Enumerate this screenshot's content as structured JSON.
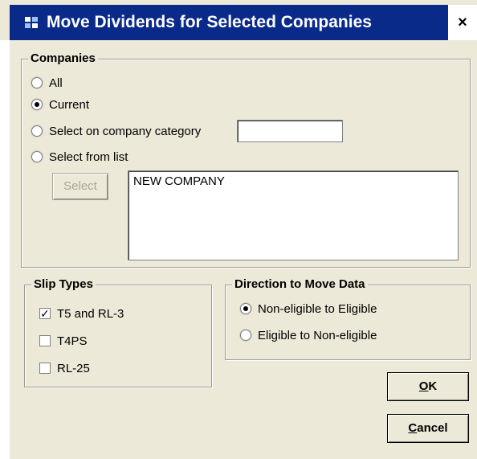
{
  "window": {
    "title": "Move Dividends for Selected Companies",
    "close_label": "×"
  },
  "companies": {
    "legend": "Companies",
    "options": [
      {
        "label": "All",
        "selected": false
      },
      {
        "label": "Current",
        "selected": true
      },
      {
        "label": "Select on company category",
        "selected": false
      },
      {
        "label": "Select from list",
        "selected": false
      }
    ],
    "category_value": "",
    "select_button": "Select",
    "list_items": [
      "NEW COMPANY"
    ]
  },
  "slip_types": {
    "legend": "Slip Types",
    "items": [
      {
        "label": "T5 and RL-3",
        "checked": true
      },
      {
        "label": "T4PS",
        "checked": false
      },
      {
        "label": "RL-25",
        "checked": false
      }
    ]
  },
  "direction": {
    "legend": "Direction to Move Data",
    "options": [
      {
        "label": "Non-eligible to Eligible",
        "selected": true
      },
      {
        "label": "Eligible to Non-eligible",
        "selected": false
      }
    ]
  },
  "buttons": {
    "ok_first": "O",
    "ok_rest": "K",
    "cancel_first": "C",
    "cancel_rest": "ancel"
  }
}
